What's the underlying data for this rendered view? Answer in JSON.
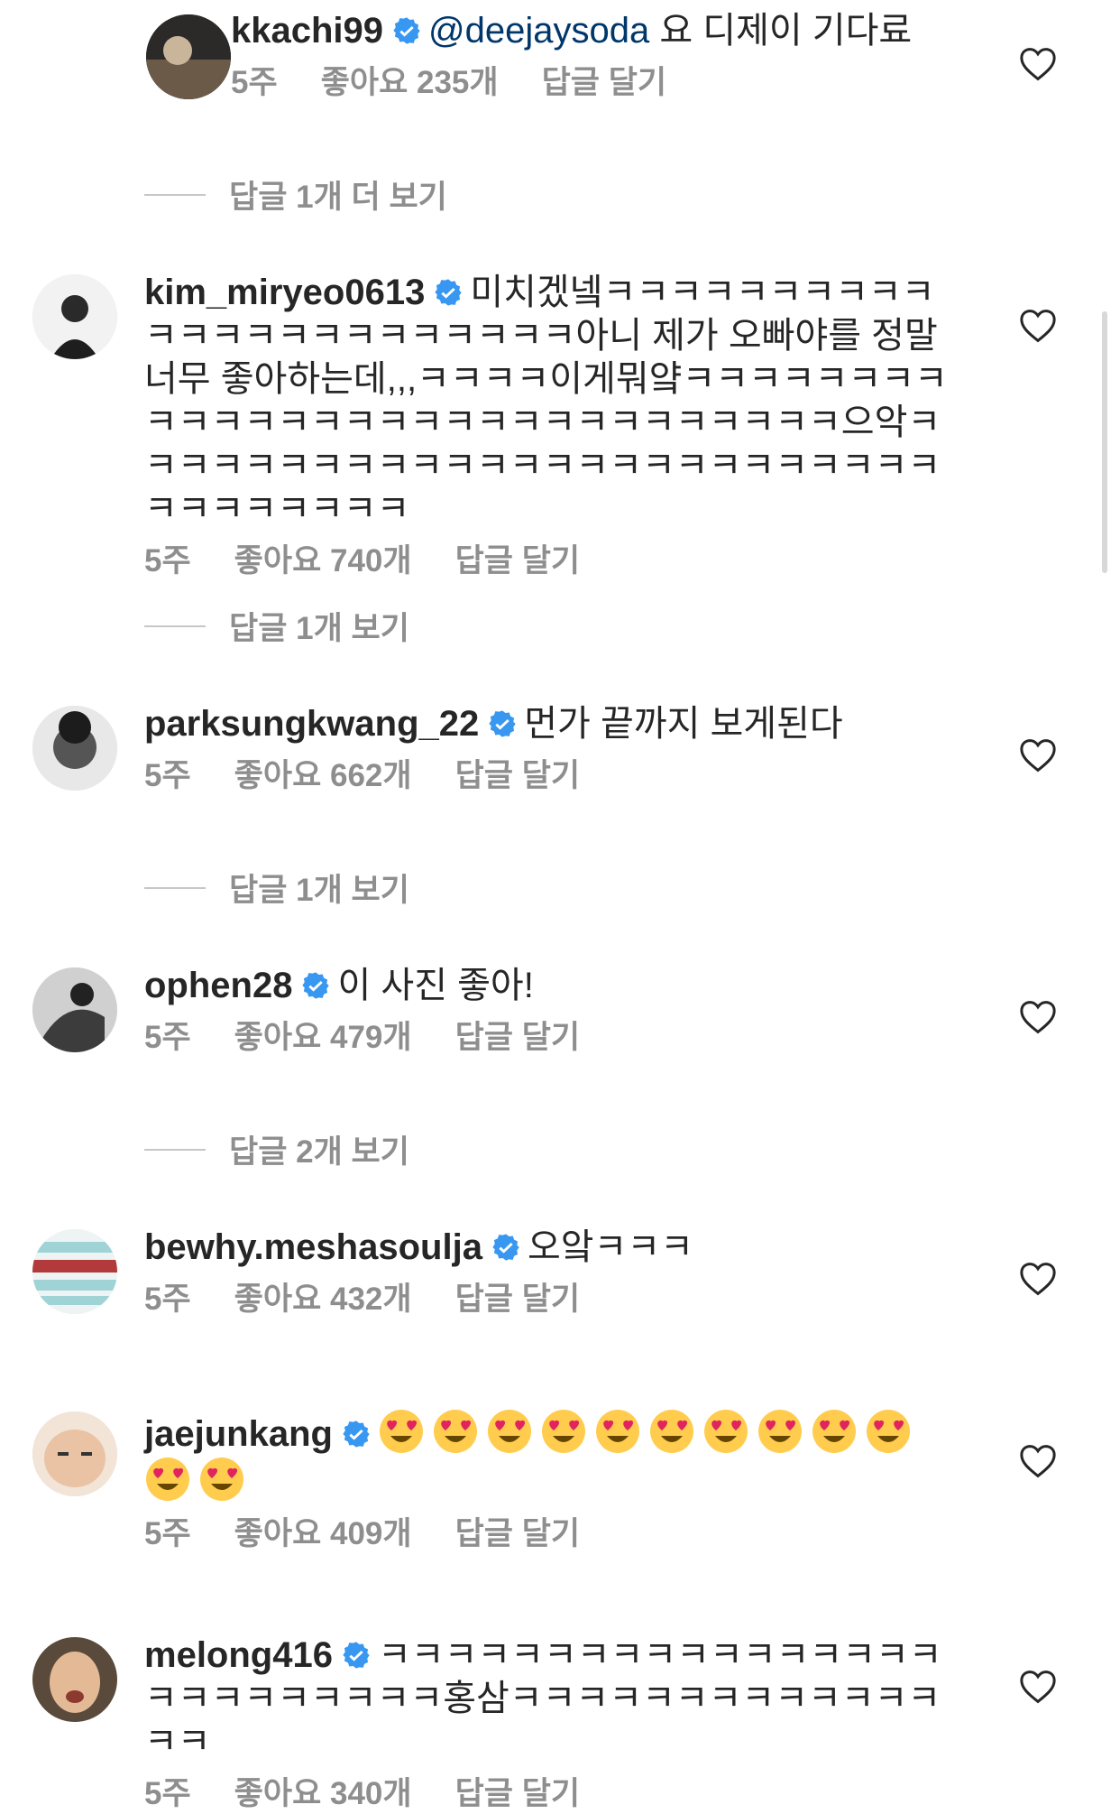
{
  "comments": [
    {
      "username": "kkachi99",
      "mention": "@deejaysoda",
      "text": " 요 디제이 기다료",
      "time": "5주",
      "likes": "좋아요 235개",
      "reply": "답글 달기",
      "view_replies": "답글 1개 더 보기"
    },
    {
      "username": "kim_miryeo0613",
      "text": "미치겠넼ㅋㅋㅋㅋㅋㅋㅋㅋㅋㅋㅋㅋㅋㅋㅋㅋㅋㅋㅋㅋㅋㅋㅋ아니 제가 오빠야를 정말 너무 좋아하는데,,,ㅋㅋㅋㅋ이게뭐얔ㅋㅋㅋㅋㅋㅋㅋㅋㅋㅋㅋㅋㅋㅋㅋㅋㅋㅋㅋㅋㅋㅋㅋㅋㅋㅋㅋㅋㅋ으악ㅋㅋㅋㅋㅋㅋㅋㅋㅋㅋㅋㅋㅋㅋㅋㅋㅋㅋㅋㅋㅋㅋㅋㅋㅋㅋㅋㅋㅋㅋㅋㅋㅋ",
      "time": "5주",
      "likes": "좋아요 740개",
      "reply": "답글 달기",
      "view_replies": "답글 1개 보기"
    },
    {
      "username": "parksungkwang_22",
      "text": "먼가 끝까지 보게된다",
      "time": "5주",
      "likes": "좋아요 662개",
      "reply": "답글 달기",
      "view_replies": "답글 1개 보기"
    },
    {
      "username": "ophen28",
      "text": "이 사진 좋아!",
      "time": "5주",
      "likes": "좋아요 479개",
      "reply": "답글 달기",
      "view_replies": "답글 2개 보기"
    },
    {
      "username": "bewhy.meshasoulja",
      "text": "오앜ㅋㅋㅋ",
      "time": "5주",
      "likes": "좋아요 432개",
      "reply": "답글 달기"
    },
    {
      "username": "jaejunkang",
      "text": "",
      "emoji_count": 12,
      "time": "5주",
      "likes": "좋아요 409개",
      "reply": "답글 달기"
    },
    {
      "username": "melong416",
      "text": "ㅋㅋㅋㅋㅋㅋㅋㅋㅋㅋㅋㅋㅋㅋㅋㅋㅋㅋㅋㅋㅋㅋㅋㅋㅋㅋ홍삼ㅋㅋㅋㅋㅋㅋㅋㅋㅋㅋㅋㅋㅋㅋㅋ",
      "time": "5주",
      "likes": "좋아요 340개",
      "reply": "답글 달기"
    }
  ],
  "colors": {
    "text": "#262626",
    "meta": "#8e8e8e",
    "mention": "#00376b",
    "verified": "#3897f0"
  },
  "icons": {
    "like": "heart-outline-icon",
    "verified": "verified-badge-icon",
    "emoji": "heart-eyes-emoji"
  }
}
